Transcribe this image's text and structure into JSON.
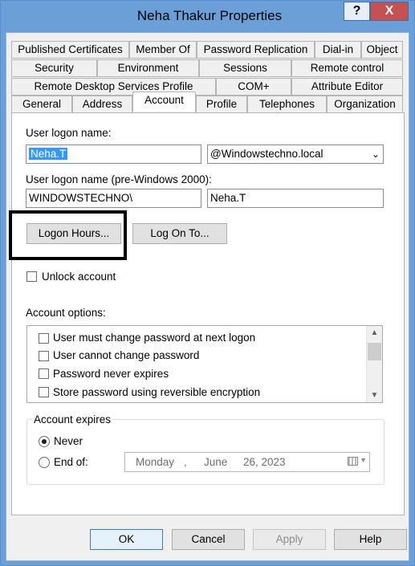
{
  "window": {
    "title": "Neha Thakur Properties",
    "help_label": "?",
    "close_label": "X"
  },
  "tabs": {
    "row1": [
      "Published Certificates",
      "Member Of",
      "Password Replication",
      "Dial-in",
      "Object"
    ],
    "row2": [
      "Security",
      "Environment",
      "Sessions",
      "Remote control"
    ],
    "row3": [
      "Remote Desktop Services Profile",
      "COM+",
      "Attribute Editor"
    ],
    "row4": [
      "General",
      "Address",
      "Account",
      "Profile",
      "Telephones",
      "Organization"
    ],
    "active": "Account"
  },
  "account": {
    "logon_name_label": "User logon name:",
    "logon_name_value": "Neha.T",
    "domain_value": "@Windowstechno.local",
    "pre2000_label": "User logon name (pre-Windows 2000):",
    "pre2000_domain": "WINDOWSTECHNO\\",
    "pre2000_name": "Neha.T",
    "logon_hours_button": "Logon Hours...",
    "log_on_to_button": "Log On To...",
    "unlock_label": "Unlock account",
    "options_label": "Account options:",
    "options": [
      "User must change password at next logon",
      "User cannot change password",
      "Password never expires",
      "Store password using reversible encryption"
    ],
    "expires_label": "Account expires",
    "never_label": "Never",
    "end_of_label": "End of:",
    "date": {
      "weekday": "Monday",
      "comma1": ",",
      "month": "June",
      "day_year": "26, 2023"
    }
  },
  "buttons": {
    "ok": "OK",
    "cancel": "Cancel",
    "apply": "Apply",
    "help": "Help"
  }
}
